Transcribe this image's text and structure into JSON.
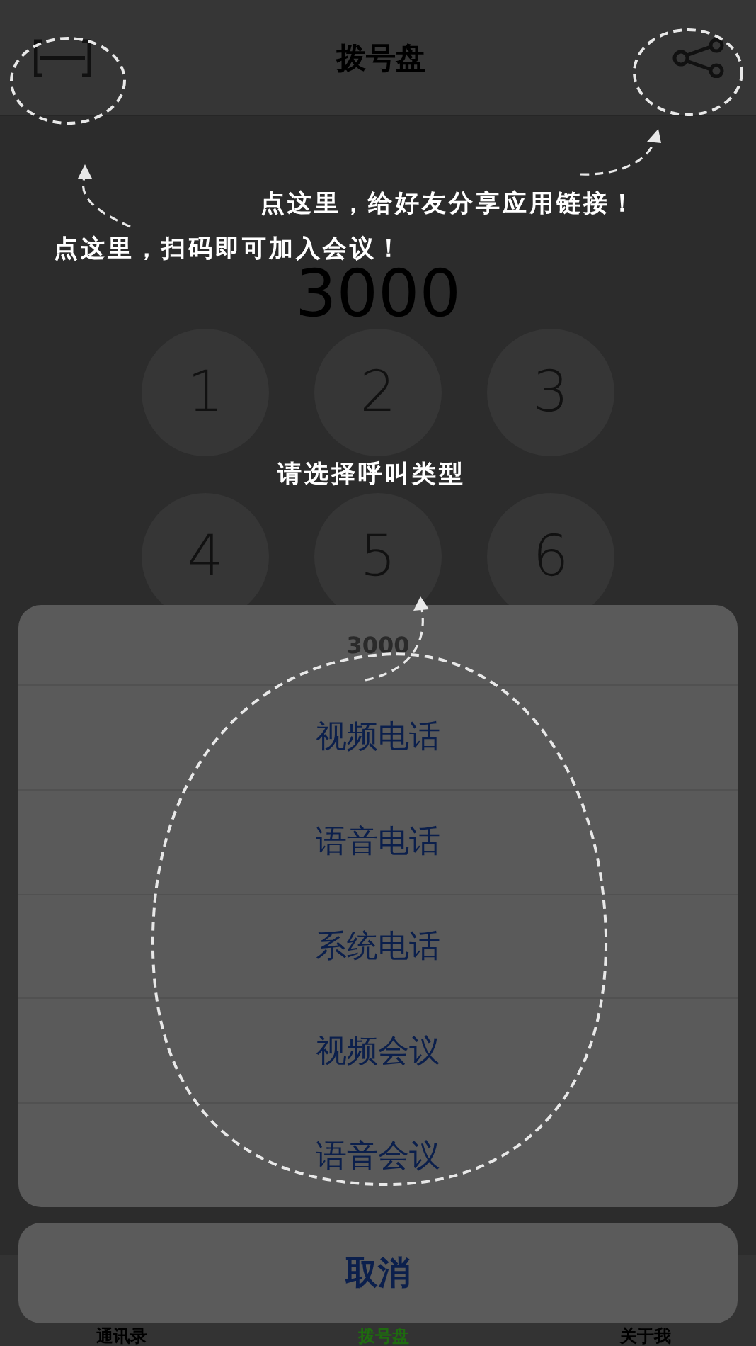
{
  "nav": {
    "title": "拨号盘"
  },
  "number": "3000",
  "keypad": [
    {
      "label": "1"
    },
    {
      "label": "2"
    },
    {
      "label": "3"
    },
    {
      "label": "4"
    },
    {
      "label": "5"
    },
    {
      "label": "6"
    }
  ],
  "tabs": [
    {
      "label": "通讯录",
      "selected": false
    },
    {
      "label": "拨号盘",
      "selected": true
    },
    {
      "label": "关于我",
      "selected": false
    }
  ],
  "action_sheet": {
    "title": "3000",
    "options": [
      "视频电话",
      "语音电话",
      "系统电话",
      "视频会议",
      "语音会议"
    ],
    "cancel": "取消"
  },
  "hints": [
    {
      "text": "点这里，给好友分享应用链接！"
    },
    {
      "text": "点这里，扫码即可加入会议！"
    },
    {
      "text": "请选择呼叫类型"
    }
  ]
}
